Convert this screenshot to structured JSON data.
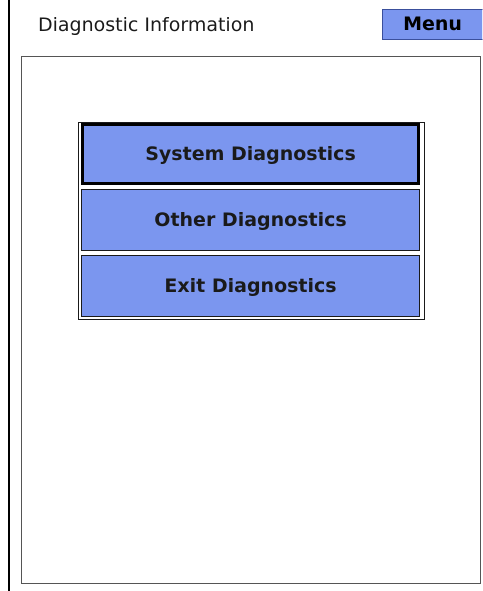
{
  "header": {
    "title": "Diagnostic Information",
    "menu_label": "Menu"
  },
  "buttons": {
    "system": "System Diagnostics",
    "other": "Other Diagnostics",
    "exit": "Exit Diagnostics"
  },
  "colors": {
    "button_fill": "#7b96ef",
    "background": "#ffffff",
    "border": "#000000"
  },
  "focused_button": "System Diagnostics"
}
